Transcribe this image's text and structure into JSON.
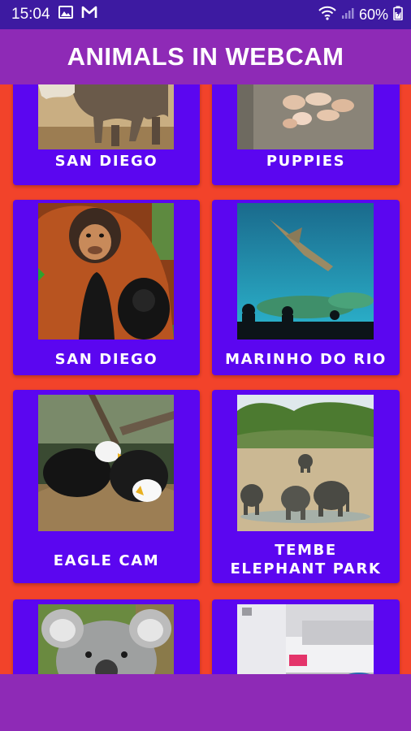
{
  "status_bar": {
    "time": "15:04",
    "battery_percent": "60%",
    "icons": [
      "image-icon",
      "mail-m-icon",
      "wifi-icon",
      "signal-icon",
      "battery-icon"
    ]
  },
  "app_bar": {
    "title": "ANIMALS IN WEBCAM"
  },
  "colors": {
    "background": "#f2432a",
    "status_bar": "#3d1aa1",
    "app_bar": "#8e2ab6",
    "card": "#5b06f0",
    "text": "#ffffff"
  },
  "cards": [
    {
      "label": "SAN DIEGO",
      "image": "elephants"
    },
    {
      "label": "PUPPIES",
      "image": "puppies"
    },
    {
      "label": "SAN DIEGO",
      "image": "orangutans"
    },
    {
      "label": "MARINHO DO RIO",
      "image": "aquarium"
    },
    {
      "label": "EAGLE CAM",
      "image": "eagles"
    },
    {
      "label": "TEMBE ELEPHANT PARK",
      "label_line1": "TEMBE",
      "label_line2": "ELEPHANT PARK",
      "image": "elephant-park"
    },
    {
      "label": "",
      "image": "koala"
    },
    {
      "label": "",
      "image": "room"
    }
  ]
}
